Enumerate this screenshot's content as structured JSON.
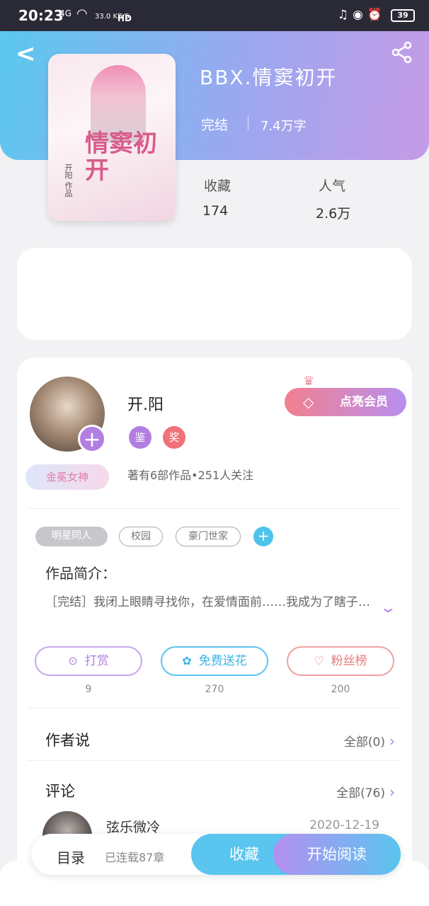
{
  "status_bar": {
    "time": "20:23",
    "signal": "4G",
    "speed": "33.0 KB/S",
    "hd": "HD",
    "battery": "39"
  },
  "header": {
    "back_icon": "chevron-left-icon",
    "share_icon": "share-icon"
  },
  "book": {
    "cover_title": "情窦初开",
    "cover_author": "开阳 作品",
    "title": "BBX.情窦初开",
    "status": "完结",
    "words": "7.4万字",
    "stats": [
      {
        "label": "收藏",
        "value": "174"
      },
      {
        "label": "人气",
        "value": "2.6万"
      }
    ]
  },
  "author": {
    "name": "开.阳",
    "badge": "金冕女神",
    "tag1": "鉴",
    "tag2": "奖",
    "stats": "著有6部作品•251人关注",
    "vip_button": "点亮会员"
  },
  "tags": [
    "明星同人",
    "校园",
    "豪门世家"
  ],
  "intro": {
    "title": "作品简介：",
    "text": "［完结］我闭上眼睛寻找你，在爱情面前……我成为了瞎子…"
  },
  "actions": [
    {
      "label": "打赏",
      "count": "9",
      "icon": "yen-icon"
    },
    {
      "label": "免费送花",
      "count": "270",
      "icon": "flower-icon"
    },
    {
      "label": "粉丝榜",
      "count": "200",
      "icon": "fan-icon"
    }
  ],
  "author_says": {
    "title": "作者说",
    "more": "全部(0)"
  },
  "comments": {
    "title": "评论",
    "more": "全部(76)",
    "first_name": "弦乐微冷",
    "first_date": "2020-12-19"
  },
  "bottom": {
    "toc": "目录",
    "chapters": "已连载87章",
    "favorite": "收藏",
    "read": "开始阅读"
  },
  "colors": {
    "accent_purple": "#b27ee0",
    "accent_blue": "#5ac5ef",
    "accent_pink": "#f2808f"
  }
}
